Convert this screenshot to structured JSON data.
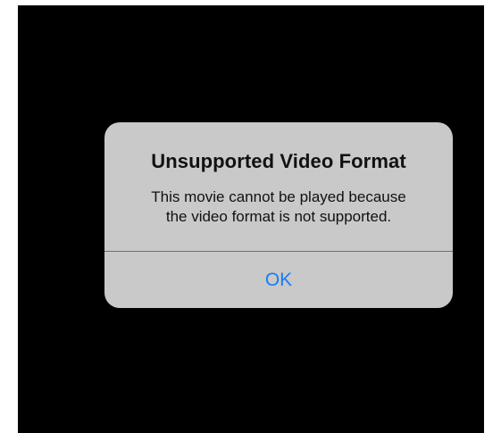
{
  "alert": {
    "title": "Unsupported Video Format",
    "message_line1": "This movie cannot be played because",
    "message_line2": "the video format is not supported.",
    "ok_label": "OK"
  },
  "colors": {
    "screen_background": "#000000",
    "alert_background": "#c9c9c9",
    "button_text": "#1a7cf5",
    "divider": "#6e6e6e"
  }
}
